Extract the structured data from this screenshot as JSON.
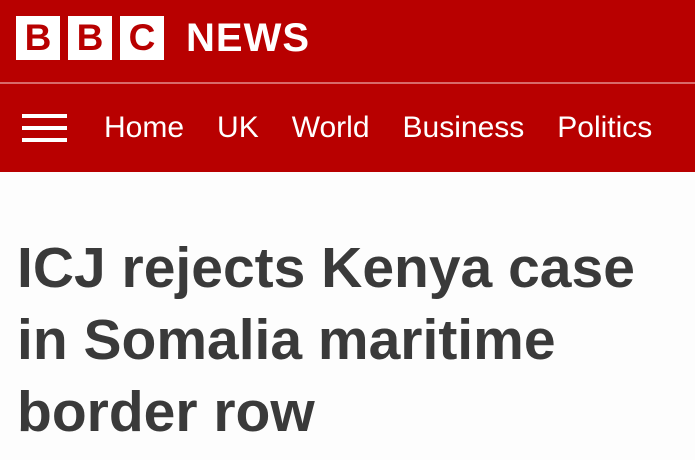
{
  "brand": {
    "letters": [
      "B",
      "B",
      "C"
    ],
    "word": "NEWS",
    "color": "#b80000"
  },
  "nav": {
    "menu_icon": "hamburger-menu-icon",
    "items": [
      "Home",
      "UK",
      "World",
      "Business",
      "Politics"
    ]
  },
  "article": {
    "headline": "ICJ rejects Kenya case in Somalia maritime border row"
  }
}
